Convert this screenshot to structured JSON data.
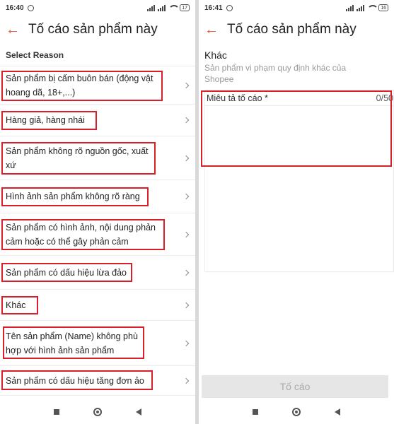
{
  "left": {
    "status": {
      "time": "16:40",
      "battery": "17"
    },
    "title": "Tố cáo sản phẩm này",
    "section_label": "Select Reason",
    "reasons": [
      {
        "line1": "Sản phẩm bị cấm buôn bán (động vật",
        "line2": "hoang dã, 18+,...)"
      },
      {
        "line1": "Hàng giả, hàng nhái",
        "line2": ""
      },
      {
        "line1": "Sản phẩm không rõ nguồn gốc, xuất",
        "line2": "xứ"
      },
      {
        "line1": "Hình ảnh sản phẩm không rõ ràng",
        "line2": ""
      },
      {
        "line1": "Sản phẩm có hình ảnh, nội dung phản",
        "line2": "cảm hoặc có thể gây phản cảm"
      },
      {
        "line1": "Sản phẩm có dấu hiệu lừa đảo",
        "line2": ""
      },
      {
        "line1": "Khác",
        "line2": ""
      },
      {
        "line1": "Tên sản phẩm (Name) không phù",
        "line2": "hợp với hình ảnh sản phẩm"
      },
      {
        "line1": "Sản phẩm có dấu hiệu tăng đơn ảo",
        "line2": ""
      }
    ]
  },
  "right": {
    "status": {
      "time": "16:41",
      "battery": "16"
    },
    "title": "Tố cáo sản phẩm này",
    "reason_title": "Khác",
    "reason_desc": "Sản phẩm vi phạm quy định khác của Shopee",
    "field_label": "Miêu tả tố cáo *",
    "field_count": "0/50",
    "field_value": "",
    "submit_label": "Tố cáo"
  },
  "colors": {
    "accent": "#ee4d2d",
    "highlight": "#d8202a",
    "disabled_bg": "#e6e6e6"
  },
  "icons": [
    "back-arrow-icon",
    "chevron-right-icon",
    "signal-icon",
    "wifi-icon",
    "battery-icon",
    "alarm-icon",
    "nav-recent-icon",
    "nav-home-icon",
    "nav-back-icon"
  ]
}
